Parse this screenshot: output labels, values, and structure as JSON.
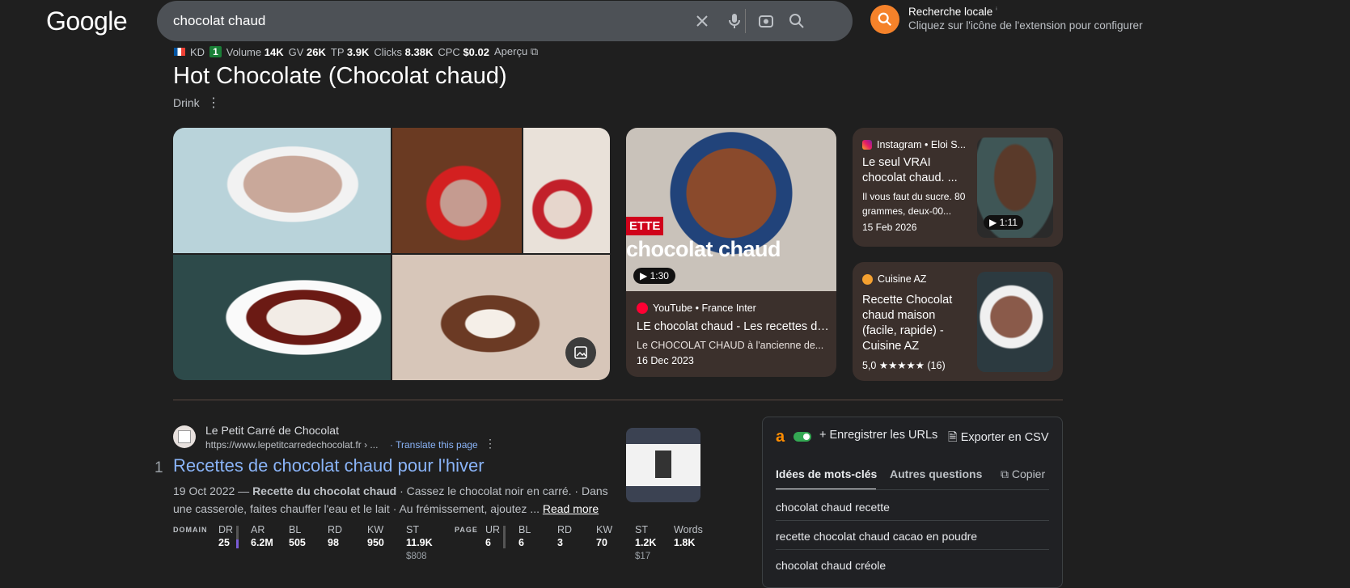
{
  "header": {
    "logo": "Google",
    "query": "chocolat chaud",
    "local_title": "Recherche locale",
    "local_info": "ⁱ",
    "local_sub": "Cliquez sur l'icône de l'extension pour configurer"
  },
  "metrics": {
    "kd_label": "KD",
    "kd_value": "1",
    "volume_label": "Volume",
    "volume_value": "14K",
    "gv_label": "GV",
    "gv_value": "26K",
    "tp_label": "TP",
    "tp_value": "3.9K",
    "clicks_label": "Clicks",
    "clicks_value": "8.38K",
    "cpc_label": "CPC",
    "cpc_value": "$0.02",
    "apercu": "Aperçu"
  },
  "entity": {
    "title": "Hot Chocolate (Chocolat chaud)",
    "type": "Drink"
  },
  "video": {
    "overlay_tag": "ETTE",
    "overlay_big": "chocolat chaud",
    "duration": "1:30",
    "source": "YouTube • France Inter",
    "title": "LE chocolat chaud - Les recettes de...",
    "desc": "Le CHOCOLAT CHAUD à l'ancienne de...",
    "date": "16 Dec 2023"
  },
  "card1": {
    "source": "Instagram • Eloi S...",
    "title": "Le seul VRAI chocolat chaud. ...",
    "desc": "Il vous faut du sucre. 80 grammes, deux-00...",
    "date": "15 Feb 2026",
    "duration": "1:11"
  },
  "card2": {
    "source": "Cuisine AZ",
    "title": "Recette Chocolat chaud maison (facile, rapide) - Cuisine AZ",
    "rating": "5,0",
    "stars": "★★★★★",
    "count": "(16)"
  },
  "result": {
    "rank": "1",
    "site": "Le Petit Carré de Chocolat",
    "url": "https://www.lepetitcarredechocolat.fr › ...",
    "translate": "· Translate this page",
    "title": "Recettes de chocolat chaud pour l'hiver",
    "date": "19 Oct 2022 — ",
    "bold1": "Recette du chocolat chaud",
    "snippet1": " · Cassez le chocolat noir en carré. · Dans une casserole, faites chauffer l'eau et le lait · Au frémissement, ajoutez ... ",
    "read_more": "Read more"
  },
  "stats": {
    "domain_head": "DOMAIN",
    "page_head": "PAGE",
    "domain": [
      {
        "l": "DR",
        "v": "25",
        "s": ""
      },
      {
        "l": "AR",
        "v": "6.2M",
        "s": ""
      },
      {
        "l": "BL",
        "v": "505",
        "s": ""
      },
      {
        "l": "RD",
        "v": "98",
        "s": ""
      },
      {
        "l": "KW",
        "v": "950",
        "s": ""
      },
      {
        "l": "ST",
        "v": "11.9K",
        "s": "$808"
      }
    ],
    "page": [
      {
        "l": "UR",
        "v": "6",
        "s": ""
      },
      {
        "l": "BL",
        "v": "6",
        "s": ""
      },
      {
        "l": "RD",
        "v": "3",
        "s": ""
      },
      {
        "l": "KW",
        "v": "70",
        "s": ""
      },
      {
        "l": "ST",
        "v": "1.2K",
        "s": "$17"
      },
      {
        "l": "Words",
        "v": "1.8K",
        "s": ""
      }
    ]
  },
  "panel": {
    "logo": "a",
    "save_urls": "Enregistrer les URLs",
    "export_csv": "Exporter en CSV",
    "tab_ideas": "Idées de mots-clés",
    "tab_questions": "Autres questions",
    "copy": "Copier",
    "keywords": [
      "chocolat chaud recette",
      "recette chocolat chaud cacao en poudre",
      "chocolat chaud créole"
    ]
  },
  "colors": {
    "accent_orange": "#f5822a",
    "link_blue": "#8ab4f8",
    "background": "#1f1f1f"
  }
}
